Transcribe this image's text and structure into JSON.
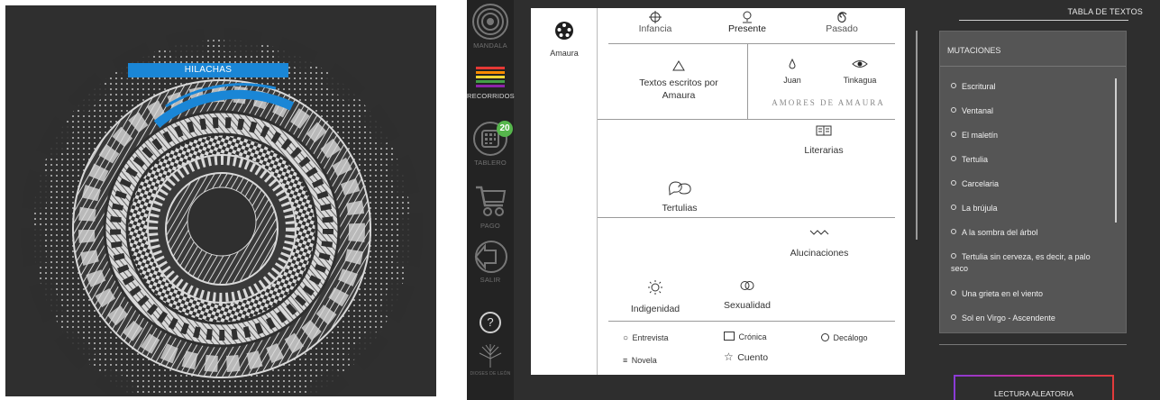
{
  "mandala": {
    "banner": "HILACHAS",
    "colors": {
      "background": "#2f2f2f",
      "banner": "#1a86d6",
      "accent_arc": "#1a86d6",
      "light": "#d9d9d9",
      "dark": "#3a3a3a"
    }
  },
  "sidebar": {
    "mandala": "MANDALA",
    "recorridos": "RECORRIDOS",
    "tablero": "TABLERO",
    "tablero_badge": "20",
    "pago": "PAGO",
    "salir": "SALIR",
    "help": "?",
    "logo_text": "DIOSES DE LEÓN"
  },
  "card": {
    "character": "Amaura",
    "tabs": [
      {
        "label": "Infancia",
        "icon": "crosshair-icon"
      },
      {
        "label": "Presente",
        "icon": "pin-icon"
      },
      {
        "label": "Pasado",
        "icon": "spiral-icon"
      }
    ],
    "textos_escritos": "Textos escritos por Amaura",
    "juan": "Juan",
    "tinkagua": "Tinkagua",
    "amores": "AMORES DE AMAURA",
    "literarias": "Literarias",
    "tertulias": "Tertulias",
    "alucinaciones": "Alucinaciones",
    "indigenidad": "Indigenidad",
    "sexualidad": "Sexualidad",
    "entrevista": "Entrevista",
    "cronica": "Crónica",
    "decalogo": "Decálogo",
    "novela": "Novela",
    "cuento": "Cuento"
  },
  "right_panel": {
    "header": "TABLA DE TEXTOS",
    "title": "MUTACIONES",
    "items": [
      "Escritural",
      "Ventanal",
      "El maletín",
      "Tertulia",
      "Carcelaria",
      "La brújula",
      "A la sombra del árbol",
      "Tertulia sin cerveza, es decir, a palo seco",
      "Una grieta en el viento",
      "Sol en Virgo - Ascendente"
    ],
    "lectura": "LECTURA ALEATORIA"
  }
}
